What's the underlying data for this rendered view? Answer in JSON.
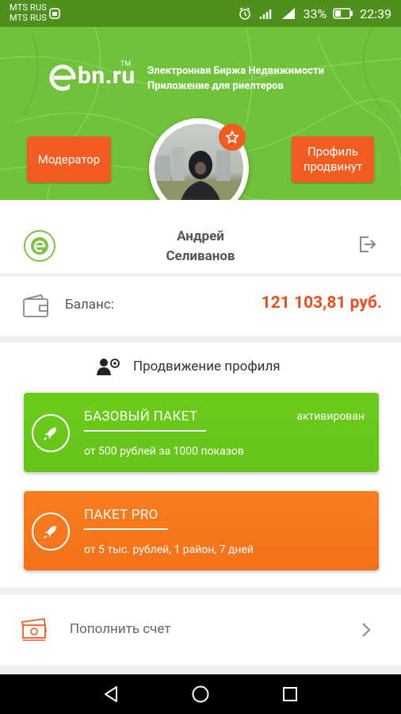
{
  "status_bar": {
    "carrier_1": "MTS RUS",
    "carrier_2": "MTS RUS",
    "battery": "33%",
    "time": "22:39"
  },
  "header": {
    "logo_text": "bn.ru",
    "tm": "TM",
    "tagline_line1": "Электронная Биржа Недвижимости",
    "tagline_line2": "Приложение для риелтеров",
    "moderator_button": "Модератор",
    "profile_button": "Профиль продвинут"
  },
  "user": {
    "first_name": "Андрей",
    "last_name": "Селиванов"
  },
  "balance": {
    "label": "Баланс:",
    "value": "121 103,81 руб."
  },
  "promotion": {
    "title": "Продвижение профиля",
    "packages": [
      {
        "name": "БАЗОВЫЙ ПАКЕТ",
        "status": "активирован",
        "description": "от 500 рублей за 1000 показов",
        "color": "#66c418"
      },
      {
        "name": "ПАКЕТ PRO",
        "status": "",
        "description": "от 5 тыс. рублей, 1 район, 7 дней",
        "color": "#f4711a"
      }
    ]
  },
  "top_up": {
    "label": "Пополнить счет"
  },
  "colors": {
    "brand_green": "#70c23a",
    "accent_orange": "#f25c1f"
  },
  "icons": [
    "signal-icon",
    "alarm-icon",
    "wifi-icon",
    "battery-icon",
    "star-icon",
    "logout-icon",
    "wallet-icon",
    "promo-person-icon",
    "rocket-icon",
    "money-icon",
    "chevron-right-icon",
    "back-icon",
    "home-icon",
    "recents-icon"
  ]
}
